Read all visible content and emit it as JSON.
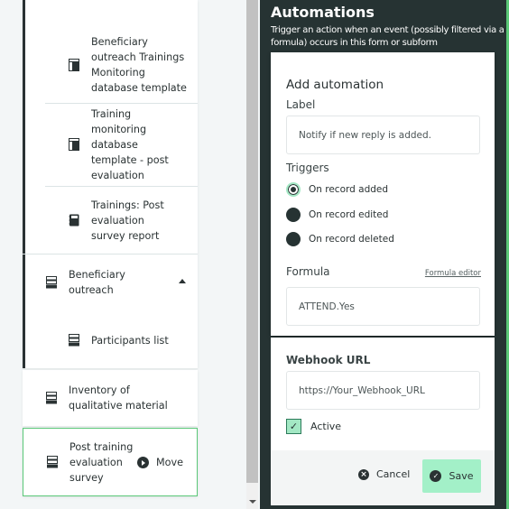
{
  "tree": {
    "items": [
      {
        "label": "Beneficiary outreach Trainings Monitoring database template",
        "icon": "database-template-icon",
        "level": "sub"
      },
      {
        "label": "Training monitoring database template - post evaluation",
        "icon": "database-template-icon",
        "level": "sub"
      },
      {
        "label": "Trainings: Post evaluation survey report",
        "icon": "report-icon",
        "level": "sub"
      },
      {
        "label": "Beneficiary outreach",
        "icon": "form-icon",
        "level": "top",
        "expanded": true
      },
      {
        "label": "Participants list",
        "icon": "form-icon",
        "level": "sub"
      },
      {
        "label": "Inventory of qualitative material",
        "icon": "form-icon",
        "level": "top"
      },
      {
        "label": "Post training evaluation survey",
        "icon": "form-icon",
        "level": "top",
        "selected": true
      }
    ],
    "move_label": "Move"
  },
  "panel": {
    "title": "Automations",
    "description": "Trigger an action when an event (possibly filtered via a formula) occurs in this form or subform",
    "heading": "Add automation",
    "label_title": "Label",
    "label_value": "Notify if new reply is added.",
    "triggers_title": "Triggers",
    "triggers": [
      {
        "label": "On record added",
        "checked": true
      },
      {
        "label": "On record edited",
        "checked": false
      },
      {
        "label": "On record deleted",
        "checked": false
      }
    ],
    "formula_title": "Formula",
    "formula_editor_link": "Formula editor",
    "formula_value": "ATTEND.Yes",
    "webhook_title": "Webhook URL",
    "webhook_value": "https://Your_Webhook_URL",
    "active_label": "Active",
    "active_checked": true,
    "cancel_label": "Cancel",
    "save_label": "Save"
  },
  "colors": {
    "panel_bg": "#263333",
    "accent_green": "#5bc878",
    "save_bg": "#a3f0c8"
  }
}
